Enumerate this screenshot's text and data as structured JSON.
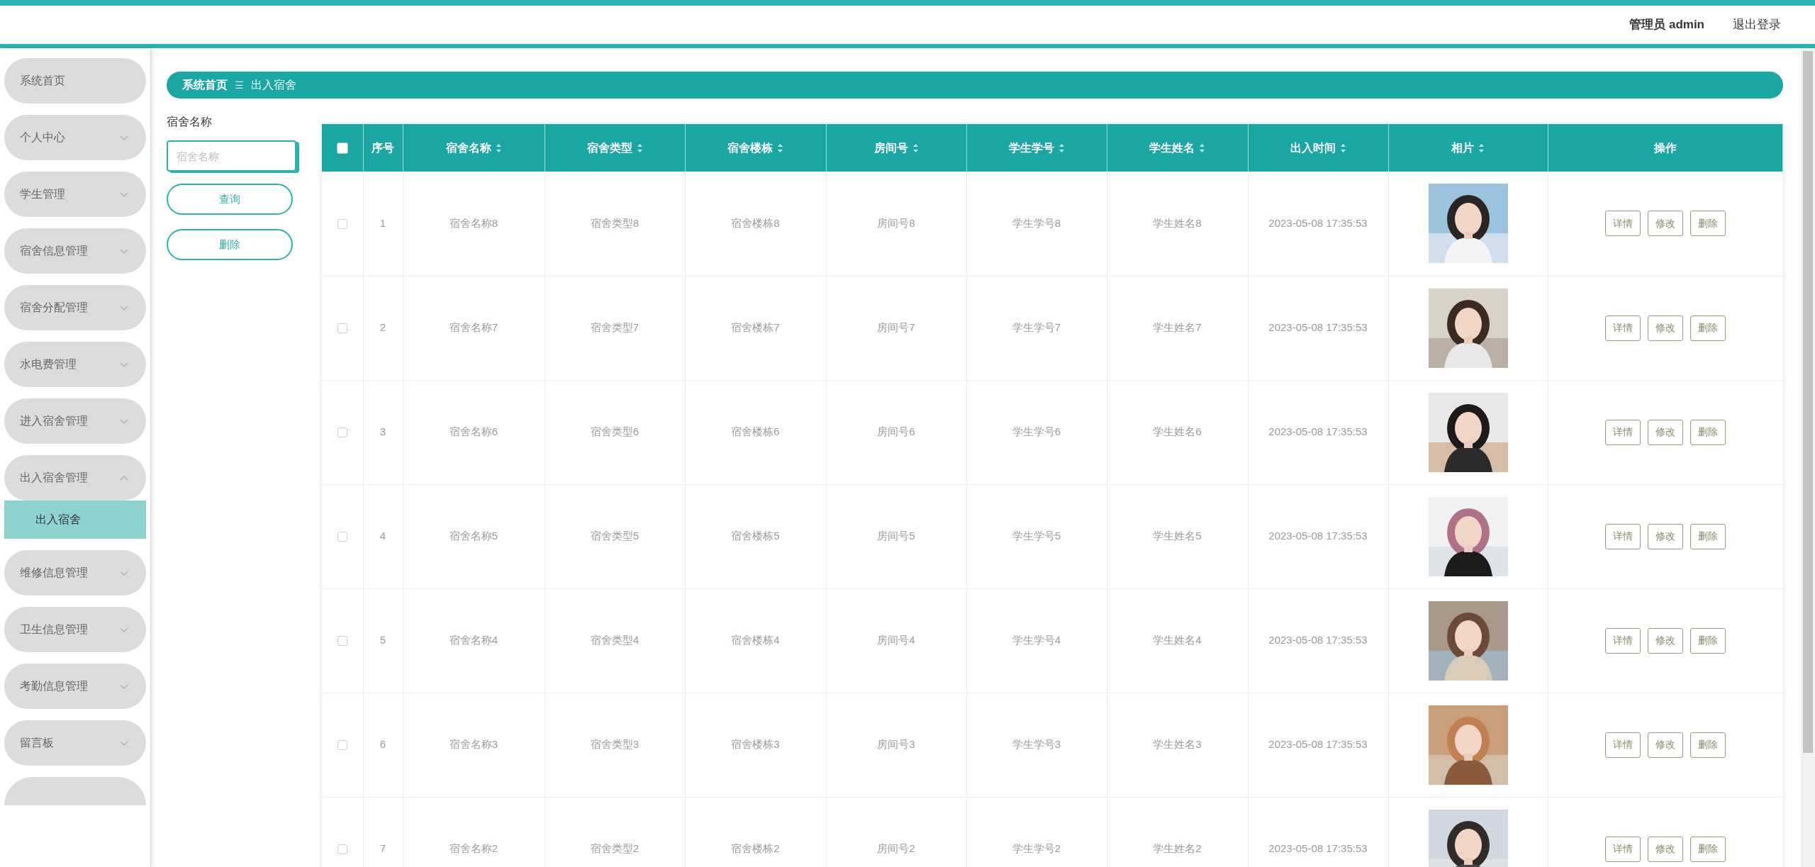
{
  "header": {
    "user_label": "管理员 admin",
    "logout": "退出登录"
  },
  "sidebar": {
    "items": [
      {
        "label": "系统首页",
        "has_arrow": false
      },
      {
        "label": "个人中心",
        "has_arrow": true,
        "expanded": false
      },
      {
        "label": "学生管理",
        "has_arrow": true,
        "expanded": false
      },
      {
        "label": "宿舍信息管理",
        "has_arrow": true,
        "expanded": false
      },
      {
        "label": "宿舍分配管理",
        "has_arrow": true,
        "expanded": false
      },
      {
        "label": "水电费管理",
        "has_arrow": true,
        "expanded": false
      },
      {
        "label": "进入宿舍管理",
        "has_arrow": true,
        "expanded": false
      },
      {
        "label": "出入宿舍管理",
        "has_arrow": true,
        "expanded": true,
        "children": [
          {
            "label": "出入宿舍",
            "selected": true
          }
        ]
      },
      {
        "label": "维修信息管理",
        "has_arrow": true,
        "expanded": false
      },
      {
        "label": "卫生信息管理",
        "has_arrow": true,
        "expanded": false
      },
      {
        "label": "考勤信息管理",
        "has_arrow": true,
        "expanded": false
      },
      {
        "label": "留言板",
        "has_arrow": true,
        "expanded": false
      }
    ]
  },
  "breadcrumb": {
    "items": [
      "系统首页",
      "出入宿舍"
    ],
    "separator": "☰"
  },
  "filter": {
    "label": "宿舍名称",
    "placeholder": "宿舍名称",
    "buttons": [
      "查询",
      "删除"
    ]
  },
  "table": {
    "select_all": {
      "checked": false
    },
    "columns": [
      {
        "label": "序号",
        "sortable": false
      },
      {
        "label": "宿舍名称",
        "sortable": true
      },
      {
        "label": "宿舍类型",
        "sortable": true
      },
      {
        "label": "宿舍楼栋",
        "sortable": true
      },
      {
        "label": "房间号",
        "sortable": true
      },
      {
        "label": "学生学号",
        "sortable": true
      },
      {
        "label": "学生姓名",
        "sortable": true
      },
      {
        "label": "出入时间",
        "sortable": true
      },
      {
        "label": "相片",
        "sortable": true
      },
      {
        "label": "操作",
        "sortable": false
      }
    ],
    "rows": [
      {
        "checked": false,
        "cells": [
          "1",
          "宿舍名称8",
          "宿舍类型8",
          "宿舍楼栋8",
          "房间号8",
          "学生学号8",
          "学生姓名8",
          "2023-05-08 17:35:53"
        ],
        "actions": [
          "详情",
          "修改",
          "删除"
        ]
      },
      {
        "checked": false,
        "cells": [
          "2",
          "宿舍名称7",
          "宿舍类型7",
          "宿舍楼栋7",
          "房间号7",
          "学生学号7",
          "学生姓名7",
          "2023-05-08 17:35:53"
        ],
        "actions": [
          "详情",
          "修改",
          "删除"
        ]
      },
      {
        "checked": false,
        "cells": [
          "3",
          "宿舍名称6",
          "宿舍类型6",
          "宿舍楼栋6",
          "房间号6",
          "学生学号6",
          "学生姓名6",
          "2023-05-08 17:35:53"
        ],
        "actions": [
          "详情",
          "修改",
          "删除"
        ]
      },
      {
        "checked": false,
        "cells": [
          "4",
          "宿舍名称5",
          "宿舍类型5",
          "宿舍楼栋5",
          "房间号5",
          "学生学号5",
          "学生姓名5",
          "2023-05-08 17:35:53"
        ],
        "actions": [
          "详情",
          "修改",
          "删除"
        ]
      },
      {
        "checked": false,
        "cells": [
          "5",
          "宿舍名称4",
          "宿舍类型4",
          "宿舍楼栋4",
          "房间号4",
          "学生学号4",
          "学生姓名4",
          "2023-05-08 17:35:53"
        ],
        "actions": [
          "详情",
          "修改",
          "删除"
        ]
      },
      {
        "checked": false,
        "cells": [
          "6",
          "宿舍名称3",
          "宿舍类型3",
          "宿舍楼栋3",
          "房间号3",
          "学生学号3",
          "学生姓名3",
          "2023-05-08 17:35:53"
        ],
        "actions": [
          "详情",
          "修改",
          "删除"
        ]
      },
      {
        "checked": false,
        "cells": [
          "7",
          "宿舍名称2",
          "宿舍类型2",
          "宿舍楼栋2",
          "房间号2",
          "学生学号2",
          "学生姓名2",
          "2023-05-08 17:35:53"
        ],
        "actions": [
          "详情",
          "修改",
          "删除"
        ]
      }
    ]
  }
}
